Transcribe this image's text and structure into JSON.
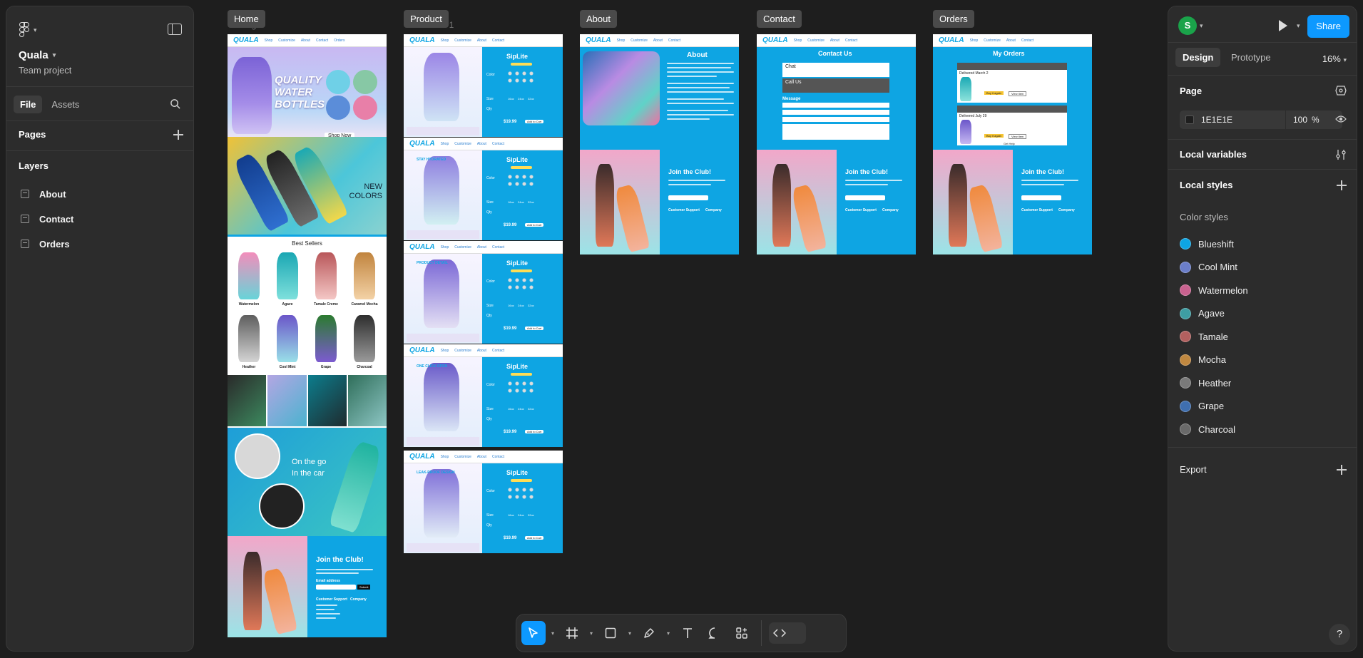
{
  "file": {
    "name": "Quala",
    "project": "Team project"
  },
  "left_tabs": [
    "File",
    "Assets"
  ],
  "pages": {
    "title": "Pages"
  },
  "layers": {
    "title": "Layers",
    "items": [
      "About",
      "Contact",
      "Orders"
    ]
  },
  "canvas": {
    "frames": [
      "Home",
      "Product",
      "About",
      "Contact",
      "Orders"
    ],
    "ghost_labels": {
      "home": "age",
      "product": "ew 1"
    },
    "home": {
      "brand": "QUALA",
      "nav": [
        "Shop",
        "Customize",
        "About",
        "Contact",
        "Orders"
      ],
      "hero_title": "QUALITY WATER BOTTLES",
      "hero_cta": "Shop Now",
      "new_colors": "NEW COLORS",
      "best_sellers": "Best Sellers",
      "flavors": [
        "Watermelon",
        "Agave",
        "Tamale Creme",
        "Caramel Mocha",
        "Heather",
        "Cool Mint",
        "Grape",
        "Charcoal"
      ],
      "on_the_go": "On the go",
      "in_the_car": "In the car",
      "club_title": "Join the Club!",
      "email_label": "Email address",
      "submit": "Submit",
      "footer_cols": [
        "Customer Support",
        "Company"
      ]
    },
    "product": {
      "title": "SipLite",
      "labels": [
        "Color",
        "Size",
        "Qty"
      ],
      "sizes": [
        "16oz",
        "24oz",
        "32oz"
      ],
      "price": "$19.99",
      "add_to_cart": "Add to Cart",
      "badges": [
        "STAY HYDRATED",
        "PRODUCT DETAIL",
        "ONE CLICK OPEN",
        "LEAK-PROOF DESIGN"
      ]
    },
    "about": {
      "title": "About"
    },
    "contact": {
      "title": "Contact Us",
      "chat": "Chat",
      "call": "Call Us",
      "message": "Message"
    },
    "orders": {
      "title": "My Orders",
      "delivered": [
        "Delivered March 2",
        "Delivered July 29"
      ],
      "buy_again": "Buy it again",
      "view_item": "View item",
      "get_help": "Get Help"
    }
  },
  "right_panel": {
    "avatar_initial": "S",
    "share_label": "Share",
    "tabs": [
      "Design",
      "Prototype"
    ],
    "zoom": "16%",
    "page_section": "Page",
    "page_color": "1E1E1E",
    "page_opacity": "100",
    "percent": "%",
    "local_variables": "Local variables",
    "local_styles": "Local styles",
    "color_styles_title": "Color styles",
    "color_styles": [
      {
        "name": "Blueshift",
        "color": "#0ea5e3"
      },
      {
        "name": "Cool Mint",
        "color": "#6b7ec9"
      },
      {
        "name": "Watermelon",
        "color": "#c9628f"
      },
      {
        "name": "Agave",
        "color": "#3e9ea3"
      },
      {
        "name": "Tamale",
        "color": "#b2605f"
      },
      {
        "name": "Mocha",
        "color": "#c08840"
      },
      {
        "name": "Heather",
        "color": "#7a7a7a"
      },
      {
        "name": "Grape",
        "color": "#3f6fb0"
      },
      {
        "name": "Charcoal",
        "color": "#6a6a6a"
      }
    ],
    "export": "Export"
  },
  "help_label": "?"
}
